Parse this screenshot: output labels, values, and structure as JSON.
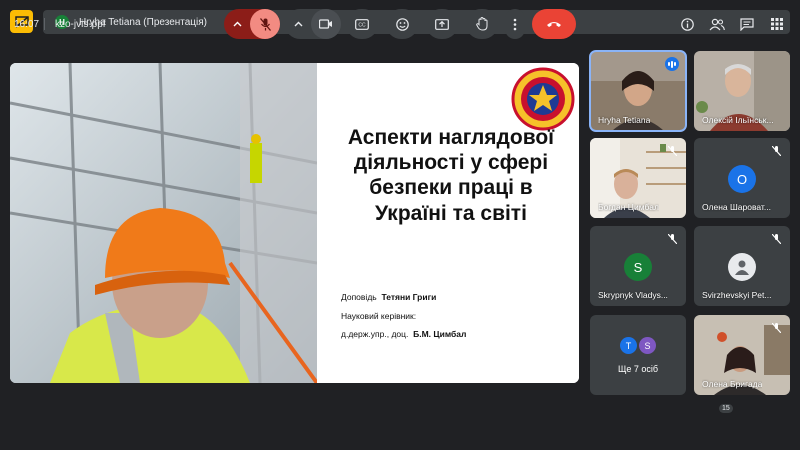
{
  "header": {
    "presenter_initial": "H",
    "presenter_title": "Hryha Tetiana (Презентація)"
  },
  "slide": {
    "title": "Аспекти наглядової діяльності у сфері безпеки праці в Україні та світі",
    "line1_prefix": "Доповідь",
    "line1_name": "Тетяни Григи",
    "line2": "Науковий керівник:",
    "line3_prefix": "д.держ.упр., доц.",
    "line3_name": "Б.М. Цимбал"
  },
  "participants": [
    {
      "name": "Hryha Tetiana",
      "type": "video",
      "speaking": true
    },
    {
      "name": "Олексій Ільїнськ...",
      "type": "video"
    },
    {
      "name": "Богдан Цимбал",
      "type": "video",
      "muted": true
    },
    {
      "name": "Олена Шароват...",
      "type": "avatar",
      "initial": "O",
      "color": "#1a73e8",
      "muted": true
    },
    {
      "name": "Skrypnyk Vladys...",
      "type": "avatar",
      "initial": "S",
      "color": "#188038",
      "muted": true
    },
    {
      "name": "Svirzhevskyi Pet...",
      "type": "avatar-generic",
      "muted": true
    },
    {
      "name": "Ще 7 осіб",
      "type": "more",
      "initials": [
        "T",
        "S"
      ]
    },
    {
      "name": "Олена Бригада",
      "type": "video",
      "muted": true
    }
  ],
  "bottom": {
    "time": "16:07",
    "meeting_code": "kzo-jvis-ppf",
    "people_count": "15"
  },
  "colors": {
    "accent": "#8ab4f8",
    "end_call": "#ea4335",
    "mic_off": "#8c1d18",
    "presenting": "#fbbc04"
  },
  "icons": [
    "presenting-icon",
    "chevron-up-icon",
    "mic-off-icon",
    "camera-icon",
    "captions-icon",
    "emoji-icon",
    "present-screen-icon",
    "raise-hand-icon",
    "more-vert-icon",
    "end-call-icon",
    "info-icon",
    "people-icon",
    "chat-icon",
    "activities-icon"
  ]
}
